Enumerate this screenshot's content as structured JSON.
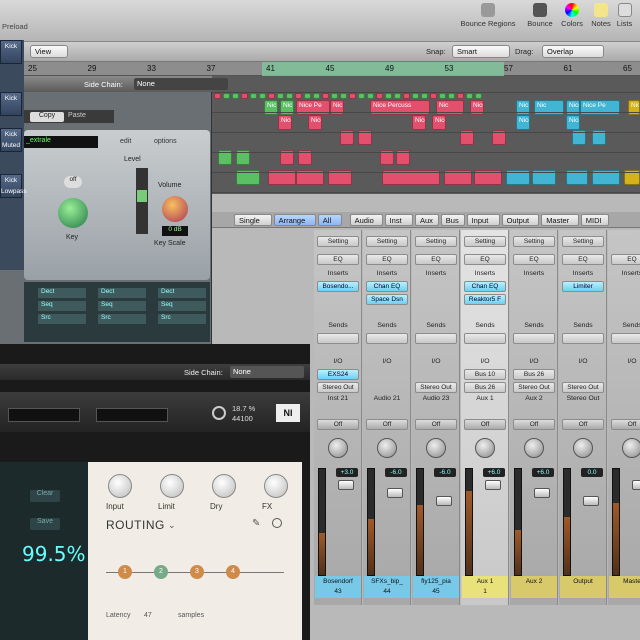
{
  "toolbar": {
    "window_title_fragment": "Preload",
    "buttons": [
      {
        "label": "Bounce Regions"
      },
      {
        "label": "Bounce"
      },
      {
        "label": "Colors"
      },
      {
        "label": "Notes"
      },
      {
        "label": "Lists"
      }
    ],
    "view_label": "View",
    "snap_label": "Snap:",
    "snap_value": "Smart",
    "drag_label": "Drag:",
    "drag_value": "Overlap"
  },
  "ruler": {
    "ticks": [
      "25",
      "29",
      "33",
      "37",
      "41",
      "45",
      "49",
      "53",
      "57",
      "61",
      "65"
    ]
  },
  "arrange": {
    "regions": [
      "Nic",
      "Nic",
      "Nice Pe",
      "Nic",
      "Nice Percuss",
      "Nic",
      "Nice Pe",
      "Nic",
      "Nic",
      "Nice",
      "Nice Pe",
      "Nice",
      "Nice",
      "Nice Percussi",
      "Nice P",
      "Nice",
      "Nice",
      "Nice P"
    ]
  },
  "mixer": {
    "tabs": [
      "Single",
      "Arrange",
      "All",
      "Audio",
      "Inst",
      "Aux",
      "Bus",
      "Input",
      "Output",
      "Master",
      "MIDI"
    ],
    "strips": [
      {
        "setting": "Setting",
        "inserts": [
          "Bosendo..."
        ],
        "io": [
          "EXS24",
          "Stereo Out"
        ],
        "name": "Inst 21",
        "db": "+3.0",
        "track": "Bosendorf",
        "num": "43"
      },
      {
        "setting": "Setting",
        "inserts": [
          "Chan EQ",
          "Space Dsn"
        ],
        "io": [
          "",
          ""
        ],
        "name": "Audio 21",
        "db": "-6.0",
        "track": "SFXs_bip_",
        "num": "44"
      },
      {
        "setting": "Setting",
        "inserts": [],
        "io": [
          "",
          "Stereo Out"
        ],
        "name": "Audio 23",
        "db": "-6.0",
        "track": "fly125_pia",
        "num": "45"
      },
      {
        "setting": "Setting",
        "inserts": [
          "Chan EQ",
          "Reaktor5 F"
        ],
        "io": [
          "Bus 10",
          "Bus 26"
        ],
        "name": "Aux 1",
        "db": "+6.0",
        "track": "Aux 1",
        "num": "1"
      },
      {
        "setting": "Setting",
        "inserts": [],
        "io": [
          "Bus 26",
          "Stereo Out"
        ],
        "name": "Aux 2",
        "db": "+6.0",
        "track": "Aux 2",
        "num": ""
      },
      {
        "setting": "Setting",
        "inserts": [
          "Limiter"
        ],
        "io": [
          "",
          "Stereo Out"
        ],
        "name": "Stereo Out",
        "db": "0.0",
        "track": "Output",
        "num": ""
      },
      {
        "setting": "",
        "inserts": [],
        "io": [
          "",
          ""
        ],
        "name": "",
        "db": "",
        "track": "Maste",
        "num": ""
      }
    ],
    "labels": {
      "eq": "EQ",
      "inserts": "Inserts",
      "sends": "Sends",
      "io": "I/O",
      "off": "Off"
    }
  },
  "pluginA": {
    "side_chain_label": "Side Chain:",
    "side_chain_value": "None",
    "copy": "Copy",
    "paste": "Paste",
    "preset_field": "_extrale",
    "edit": "edit",
    "options": "options",
    "level": "Level",
    "volume": "Volume",
    "key": "Key",
    "key_scale": "Key Scale",
    "off_btn": "off",
    "db_readout": "0 dB",
    "sidebar": [
      "Kick",
      "Kick",
      "Kick Muted",
      "Kick Lowpass"
    ],
    "grid_labels": [
      "Dect",
      "Seq",
      "Src",
      "Dect",
      "Seq",
      "Src",
      "Dect",
      "Seq",
      "Src"
    ]
  },
  "pluginB": {
    "side_chain_label": "Side Chain:",
    "side_chain_value": "None",
    "cpu": "18.7 %",
    "rate": "44100",
    "clear": "Clear",
    "save": "Save",
    "percent": "99.5%",
    "knobs": [
      "Input",
      "Limit",
      "Dry",
      "FX"
    ],
    "routing": "ROUTING",
    "latency_label": "Latency",
    "latency_value": "47",
    "latency_unit": "samples",
    "nodes": [
      "1",
      "2",
      "3",
      "4"
    ]
  }
}
